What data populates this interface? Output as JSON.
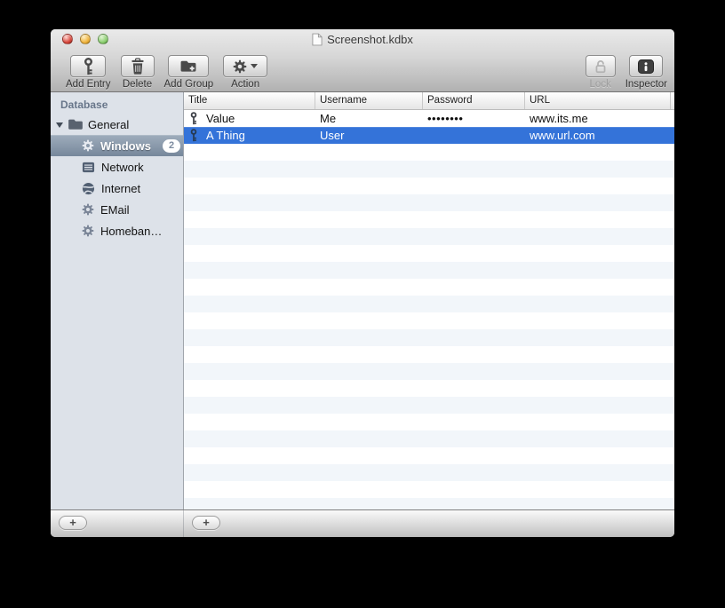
{
  "window": {
    "title": "Screenshot.kdbx"
  },
  "toolbar": {
    "buttons": [
      {
        "label": "Add Entry",
        "icon": "key-icon"
      },
      {
        "label": "Delete",
        "icon": "trash-icon"
      },
      {
        "label": "Add Group",
        "icon": "folder-plus-icon"
      },
      {
        "label": "Action",
        "icon": "gear-icon"
      }
    ],
    "right_buttons": [
      {
        "label": "Lock",
        "icon": "lock-open-icon",
        "disabled": true
      },
      {
        "label": "Inspector",
        "icon": "info-icon",
        "disabled": false
      }
    ]
  },
  "sidebar": {
    "header": "Database",
    "groups": [
      {
        "label": "General",
        "icon": "folder-icon",
        "expanded": true
      },
      {
        "label": "Windows",
        "icon": "gear-icon",
        "badge": "2",
        "selected": true
      },
      {
        "label": "Network",
        "icon": "network-icon"
      },
      {
        "label": "Internet",
        "icon": "globe-icon"
      },
      {
        "label": "EMail",
        "icon": "gear-icon"
      },
      {
        "label": "Homeban…",
        "icon": "gear-icon"
      }
    ]
  },
  "table": {
    "columns": [
      "Title",
      "Username",
      "Password",
      "URL"
    ],
    "rows": [
      {
        "title": "Value",
        "username": "Me",
        "password": "••••••••",
        "url": "www.its.me",
        "selected": false
      },
      {
        "title": "A Thing",
        "username": "User",
        "password": "",
        "url": "www.url.com",
        "selected": true
      }
    ]
  },
  "bottom_bar": {
    "add_group_button": "+",
    "add_entry_button": "+"
  },
  "colors": {
    "selection_blue": "#3473d9",
    "sidebar_bg": "#dde2e9",
    "stripe_blue": "#f2f6fa",
    "sidebar_selection_top": "#9fadbc",
    "sidebar_selection_bottom": "#76879b",
    "traffic_red": "#d8473c",
    "traffic_yellow": "#f0b43e",
    "traffic_green": "#8ccf71"
  }
}
